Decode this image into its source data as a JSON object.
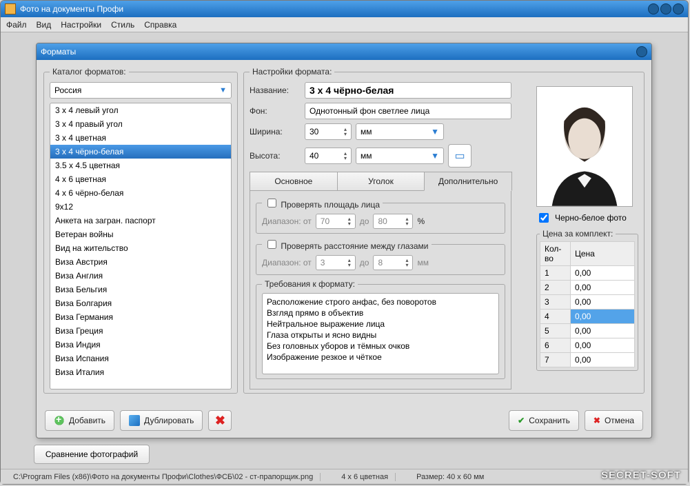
{
  "app": {
    "title": "Фото на документы Профи"
  },
  "menu": [
    "Файл",
    "Вид",
    "Настройки",
    "Стиль",
    "Справка"
  ],
  "status": {
    "path": "C:\\Program Files (x86)\\Фото на документы Профи\\Clothes\\ФСБ\\02 - ст-прапорщик.png",
    "format": "4 x 6 цветная",
    "size": "Размер: 40 x 60 мм"
  },
  "watermark": "SECRET-SOFT",
  "dialog": {
    "title": "Форматы",
    "catalog_legend": "Каталог форматов:",
    "settings_legend": "Настройки формата:",
    "country": "Россия",
    "formats": [
      "3 x 4 левый угол",
      "3 x 4 правый угол",
      "3 х 4 цветная",
      "3 х 4 чёрно-белая",
      "3.5 x 4.5 цветная",
      "4 х 6 цветная",
      "4 х 6 чёрно-белая",
      "9x12",
      "Анкета на загран. паспорт",
      "Ветеран войны",
      "Вид на жительство",
      "Виза Австрия",
      "Виза Англия",
      "Виза Бельгия",
      "Виза Болгария",
      "Виза Германия",
      "Виза Греция",
      "Виза Индия",
      "Виза Испания",
      "Виза Италия"
    ],
    "selected_index": 3,
    "fields": {
      "name_label": "Название:",
      "name_value": "3 х 4 чёрно-белая",
      "bg_label": "Фон:",
      "bg_value": "Однотонный фон светлее лица",
      "width_label": "Ширина:",
      "width_value": "30",
      "height_label": "Высота:",
      "height_value": "40",
      "unit": "мм"
    },
    "tabs": [
      "Основное",
      "Уголок",
      "Дополнительно"
    ],
    "active_tab": 2,
    "face_area": {
      "legend": "Проверять площадь лица",
      "range_label": "Диапазон: от",
      "from": "70",
      "to_label": "до",
      "to": "80",
      "unit": "%"
    },
    "eye_dist": {
      "legend": "Проверять расстояние между глазами",
      "range_label": "Диапазон: от",
      "from": "3",
      "to_label": "до",
      "to": "8",
      "unit": "мм"
    },
    "requirements": {
      "legend": "Требования к формату:",
      "items": [
        "Расположение строго анфас, без поворотов",
        "Взгляд прямо в объектив",
        "Нейтральное выражение лица",
        "Глаза открыты и ясно видны",
        "Без головных уборов и тёмных очков",
        "Изображение резкое и чёткое"
      ]
    },
    "bw_checkbox": "Черно-белое фото",
    "price": {
      "legend": "Цена за комплект:",
      "headers": [
        "Кол-во",
        "Цена"
      ],
      "rows": [
        {
          "qty": "1",
          "price": "0,00"
        },
        {
          "qty": "2",
          "price": "0,00"
        },
        {
          "qty": "3",
          "price": "0,00"
        },
        {
          "qty": "4",
          "price": "0,00"
        },
        {
          "qty": "5",
          "price": "0,00"
        },
        {
          "qty": "6",
          "price": "0,00"
        },
        {
          "qty": "7",
          "price": "0,00"
        }
      ],
      "selected_row": 3
    },
    "buttons": {
      "add": "Добавить",
      "duplicate": "Дублировать",
      "save": "Сохранить",
      "cancel": "Отмена"
    }
  },
  "back_button": "Сравнение фотографий"
}
